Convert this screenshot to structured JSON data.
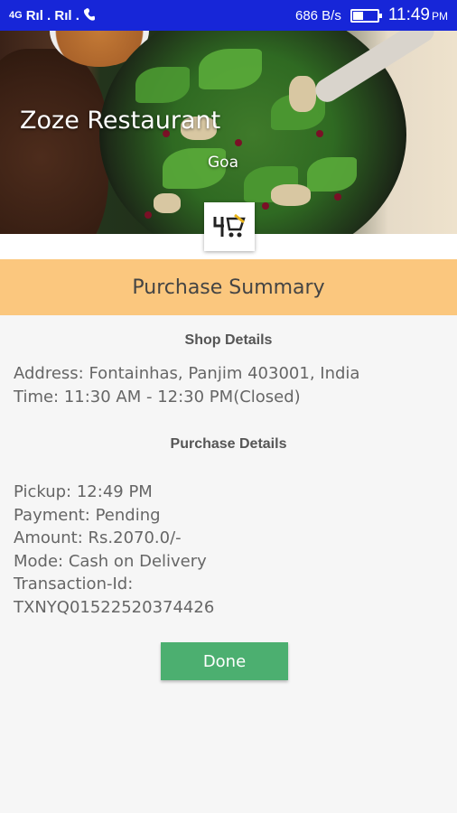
{
  "status_bar": {
    "network_left": "4G",
    "signal_label": "Rıl . Rıl .",
    "speed": "686 B/s",
    "time": "11:49",
    "ampm": "PM"
  },
  "hero": {
    "title": "Zoze Restaurant",
    "subtitle": "Goa",
    "logo_icon": "store-logo-icon"
  },
  "summary_title": "Purchase Summary",
  "shop": {
    "heading": "Shop Details",
    "address": "Address:  Fontainhas, Panjim 403001, India",
    "time": "Time: 11:30 AM - 12:30 PM(Closed)"
  },
  "purchase": {
    "heading": "Purchase Details",
    "pickup": "Pickup:   12:49 PM",
    "payment": "Payment:  Pending",
    "amount": "Amount:   Rs.2070.0/-",
    "mode": "Mode: Cash on Delivery",
    "transaction_label": "Transaction-Id:",
    "transaction_id": "TXNYQ01522520374426"
  },
  "done_label": "Done",
  "colors": {
    "status_bar": "#1726d8",
    "summary_band": "#fbc77e",
    "done_button": "#4caf70"
  }
}
